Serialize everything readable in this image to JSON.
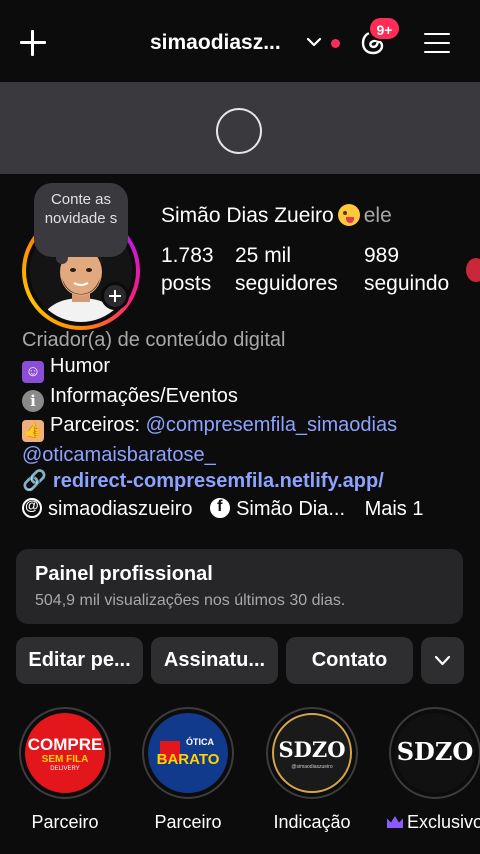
{
  "header": {
    "username": "simaodiasz...",
    "notification_badge": "9+"
  },
  "profile": {
    "note": "Conte as novidade s",
    "display_name": "Simão Dias Zueiro",
    "pronoun": "ele",
    "stats": {
      "posts_count": "1.783",
      "posts_label": "posts",
      "followers_count": "25 mil",
      "followers_label": "seguidores",
      "following_count": "989",
      "following_label": "seguindo"
    }
  },
  "bio": {
    "category": "Criador(a) de conteúdo digital",
    "line1": "Humor",
    "line2": "Informações/Eventos",
    "line3_prefix": "Parceiros:",
    "mention1": "@compresemfila_simaodias",
    "mention2": "@oticamaisbaratose_",
    "link": "redirect-compresemfila.netlify.app/"
  },
  "links_row": {
    "threads": "simaodiaszueiro",
    "facebook": "Simão Dia...",
    "more": "Mais 1"
  },
  "pro_panel": {
    "title": "Painel profissional",
    "subtitle": "504,9 mil visualizações nos últimos 30 dias."
  },
  "buttons": {
    "edit": "Editar pe...",
    "subscriptions": "Assinatu...",
    "contact": "Contato"
  },
  "highlights": [
    {
      "label": "Parceiro",
      "logo_text_1": "COMPRE",
      "logo_text_2": "SEM FILA",
      "logo_text_3": "DELIVERY"
    },
    {
      "label": "Parceiro",
      "logo_text_1": "ÓTICA",
      "logo_text_2": "BARATO"
    },
    {
      "label": "Indicação",
      "logo_text_1": "SDZO",
      "logo_text_2": "@simaodiaszueiro"
    },
    {
      "label": "Exclusivo",
      "logo_text_1": "SDZO"
    }
  ],
  "colors": {
    "background": "#0c0c0c",
    "link": "#8ea2ff",
    "badge": "#ff2d55",
    "panel": "#262629"
  }
}
